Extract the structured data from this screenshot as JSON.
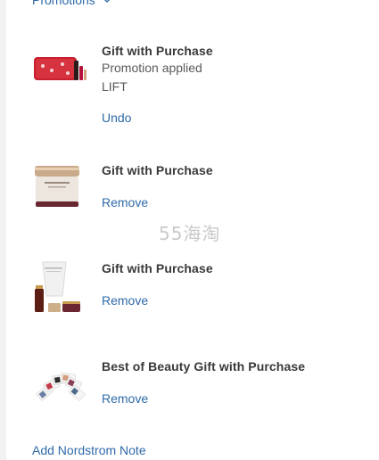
{
  "promotions": {
    "toggle_label": "Promotions"
  },
  "items": [
    {
      "title": "Gift with Purchase",
      "status": "Promotion applied",
      "code": "LIFT",
      "action": "Undo",
      "image": "red-cosmetics-gift-set"
    },
    {
      "title": "Gift with Purchase",
      "action": "Remove",
      "image": "cream-jar"
    },
    {
      "title": "Gift with Purchase",
      "action": "Remove",
      "image": "skincare-trio"
    },
    {
      "title": "Best of Beauty Gift with Purchase",
      "action": "Remove",
      "image": "sample-cards-fan"
    }
  ],
  "footer": {
    "note_link": "Add Nordstrom Note"
  },
  "watermark": "55海淘",
  "colors": {
    "link": "#2f6aa8",
    "text": "#393939"
  }
}
